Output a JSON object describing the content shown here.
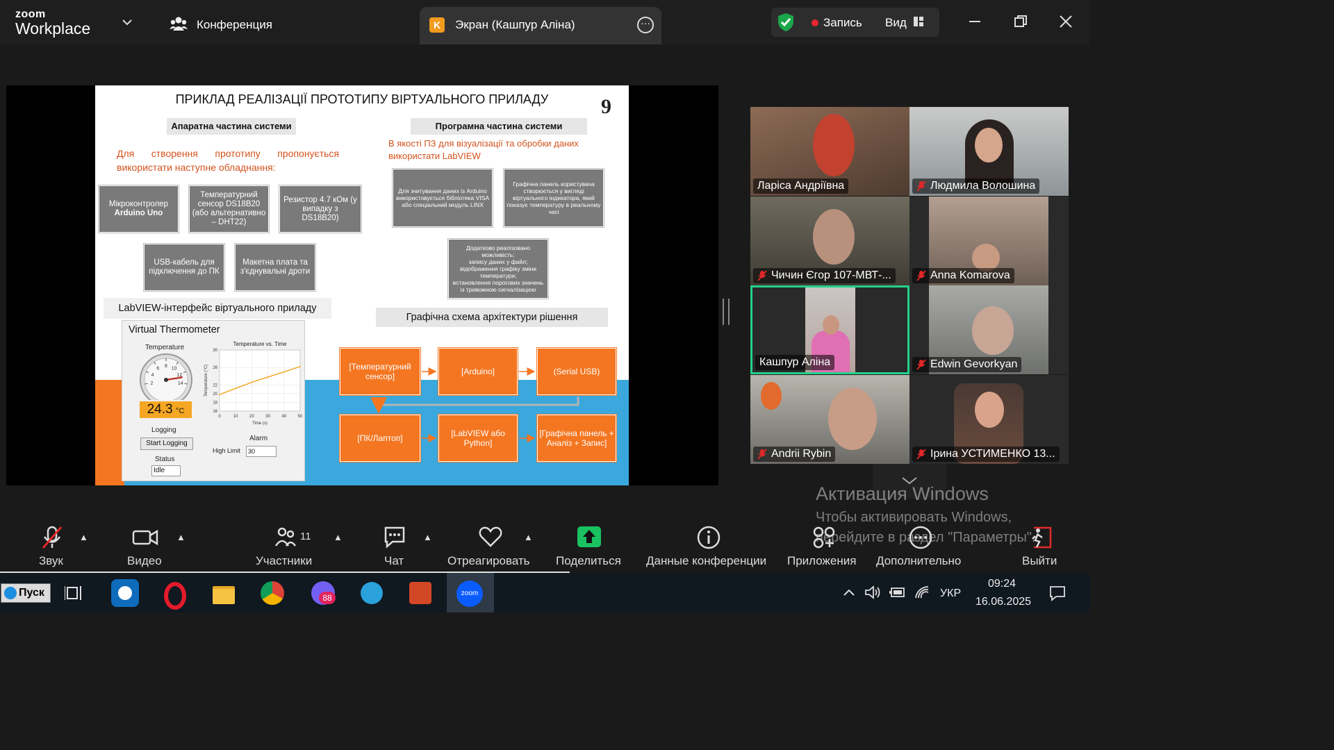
{
  "app": {
    "logo_top": "zoom",
    "logo_bottom": "Workplace"
  },
  "topbar": {
    "conference_label": "Конференция",
    "screen_tab_badge": "K",
    "screen_tab_label": "Экран (Кашпур Аліна)",
    "record_label": "Запись",
    "view_label": "Вид",
    "shield_color": "#1aa64a",
    "record_color": "#e8262f"
  },
  "slide": {
    "title": "ПРИКЛАД РЕАЛІЗАЦІЇ ПРОТОТИПУ ВІРТУАЛЬНОГО ПРИЛАДУ",
    "page_number": "9",
    "hardware_header": "Апаратна частина системи",
    "software_header": "Програмна частина системи",
    "hardware_text_1": "Для створення прототипу пропонується",
    "hardware_text_2": "використати наступне обладнання:",
    "software_text_1": "В якості ПЗ для візуалізації та обробки даних",
    "software_text_2": "використати LabVIEW",
    "hw_boxes": [
      {
        "l1": "Мікроконтролер",
        "l2": "Arduino Uno"
      },
      {
        "l1": "Температурний сенсор DS18B20",
        "l2": "(або альтернативно – DHT22)"
      },
      {
        "l1": "Резистор 4.7 кОм (у випадку з",
        "l2": "DS18B20)"
      },
      {
        "l1": "USB-кабель для",
        "l2": "підключення до ПК"
      },
      {
        "l1": "Макетна плата та",
        "l2": "з'єднувальні дроти"
      }
    ],
    "sw_box_1": "Для зчитування даних із Arduino використовується бібліотека VISA або спеціальний модуль LINX",
    "sw_box_2": "Графічна панель користувача створюється у вигляді віртуального індикатора, який показує температуру в реальному часі",
    "sw_box_3_lines": [
      "Додатково реалізовано можливість:",
      "запису даних у файл;",
      "відображення графіку зміни температури;",
      "встановлення порогових значень із тривожною сигналізацією"
    ],
    "labview_header": "LabVIEW-інтерфейс віртуального приладу",
    "arch_header": "Графічна схема архітектури рішення",
    "vt": {
      "title": "Virtual Thermometer",
      "gauge_label": "Temperature",
      "gauge_ticks": [
        "2",
        "4",
        "6",
        "8",
        "10",
        "12",
        "14"
      ],
      "gauge_value": 12.8,
      "readout_value": "24.3",
      "readout_unit": "°C",
      "logging_label": "Logging",
      "start_button": "Start Logging",
      "status_label": "Status",
      "status_value": "Idle",
      "alarm_label": "Alarm",
      "high_limit_label": "High Limit",
      "high_limit_value": "30"
    },
    "chart_data": {
      "type": "line",
      "title": "Temperature vs. Time",
      "xlabel": "Time (s)",
      "ylabel": "Temperature (°C)",
      "x": [
        0,
        10,
        20,
        30,
        40,
        50
      ],
      "series": [
        {
          "values": [
            19.8,
            21.2,
            22.6,
            23.8,
            25.0,
            26.2
          ]
        }
      ],
      "xlim": [
        0,
        50
      ],
      "ylim": [
        16,
        30
      ],
      "xticks": [
        "0",
        "10",
        "20",
        "30",
        "40",
        "50"
      ],
      "yticks": [
        "16",
        "18",
        "20",
        "22",
        "26",
        "30"
      ],
      "line_color": "#f2a31b",
      "grid": true
    },
    "arch_boxes": [
      "[Температурний сенсор]",
      "[Arduino]",
      "(Serial USB)",
      "[ПК/Лаптоп]",
      "[LabVIEW або Python]",
      "[Графічна панель + Аналіз + Запис]"
    ]
  },
  "participants": [
    {
      "name": "Ларіса Андріївна",
      "muted": false,
      "bg": "#6d5a48"
    },
    {
      "name": "Людмила Волошина",
      "muted": true,
      "bg": "#9aa3a8"
    },
    {
      "name": "Чичин Єгор 107-МВТ-...",
      "muted": true,
      "bg": "#5b574d"
    },
    {
      "name": "Anna Komarova",
      "muted": true,
      "bg": "#8a7b70"
    },
    {
      "name": "Кашпур Аліна",
      "muted": false,
      "bg": "#2b2b2b",
      "active": true
    },
    {
      "name": "Edwin Gevorkyan",
      "muted": true,
      "bg": "#7c7e7a"
    },
    {
      "name": "Andrii Rybin",
      "muted": true,
      "bg": "#7d7d79"
    },
    {
      "name": "Ірина УСТИМЕНКО 13...",
      "muted": true,
      "bg": "#2b2b2b"
    }
  ],
  "watermark": {
    "title": "Активация Windows",
    "line1": "Чтобы активировать Windows,",
    "line2": "перейдите в раздел \"Параметры\"."
  },
  "toolbar": {
    "audio": "Звук",
    "video": "Видео",
    "participants": "Участники",
    "participants_count": "11",
    "chat": "Чат",
    "react": "Отреагировать",
    "share": "Поделиться",
    "info": "Данные конференции",
    "apps": "Приложения",
    "more": "Дополнительно",
    "leave": "Выйти",
    "share_color": "#1ac261",
    "leave_color": "#e02828"
  },
  "taskbar": {
    "start_label": "Пуск",
    "lang": "УКР",
    "time": "09:24",
    "date": "16.06.2025",
    "viber_badge": "88"
  }
}
